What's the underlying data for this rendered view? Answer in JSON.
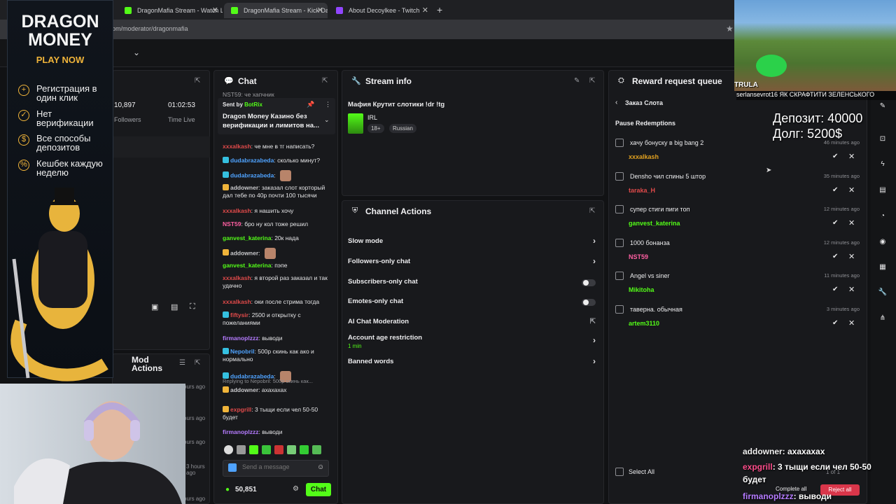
{
  "browser": {
    "tabs": [
      {
        "title": "DragonMafia Stream - Watch Li",
        "active": false
      },
      {
        "title": "DragonMafia Stream - Kick Da",
        "active": true
      },
      {
        "title": "About Decoylkee - Twitch",
        "active": false
      }
    ],
    "url": "om/moderator/dragonmafia"
  },
  "ad": {
    "title": "DRAGON MONEY",
    "cta": "PLAY NOW",
    "items": [
      "Регистрация в один клик",
      "Нет верификации",
      "Все способы депозитов",
      "Кешбек каждую неделю"
    ]
  },
  "stats": {
    "followers_value": "10,897",
    "followers_label": "Followers",
    "time_value": "01:02:53",
    "time_label": "Time Live"
  },
  "mod_actions": {
    "title": "Mod Actions",
    "times": [
      "ours ago",
      "ours ago",
      "ours ago",
      "ours ago",
      "3 hours ago",
      "ours ago"
    ]
  },
  "chat": {
    "title": "Chat",
    "top_cut": "NST59: че хапчник",
    "pinned": {
      "sent_by": "Sent by",
      "bot": "BotRix",
      "text": "Dragon Money Казино без верификации и лимитов на..."
    },
    "messages": [
      {
        "user": "xxxalkash",
        "color": "u-red",
        "badge": "",
        "text": "че мне в тг написать?"
      },
      {
        "user": "dudabrazabeda",
        "color": "u-blue",
        "badge": "k",
        "text": "сколько минут?"
      },
      {
        "user": "dudabrazabeda",
        "color": "u-blue",
        "badge": "k",
        "text": ""
      },
      {
        "user": "addowner",
        "color": "u-lt",
        "badge": "g",
        "text": "заказал слот корторый дал тебе по 40р почти 100 тысячи"
      },
      {
        "user": "xxxalkash",
        "color": "u-red",
        "badge": "",
        "text": "я нашить хочу"
      },
      {
        "user": "NST59",
        "color": "u-pink",
        "badge": "",
        "text": "бро ну кол тоже решил"
      },
      {
        "user": "ganvest_katerina",
        "color": "u-green",
        "badge": "",
        "text": "20к нада"
      },
      {
        "user": "addowner",
        "color": "u-lt",
        "badge": "g",
        "text": ""
      },
      {
        "user": "ganvest_katerina",
        "color": "u-green",
        "badge": "",
        "text": "пэпе"
      },
      {
        "user": "xxxalkash",
        "color": "u-red",
        "badge": "",
        "text": "я второй раз заказал и так удачно"
      },
      {
        "user": "xxxalkash",
        "color": "u-red",
        "badge": "",
        "text": "оки после стрима тогда"
      },
      {
        "user": "fiftysir",
        "color": "u-red",
        "badge": "k",
        "text": "2500 и открытку с пожеланиями"
      },
      {
        "user": "firmanoplzzz",
        "color": "u-purple",
        "badge": "",
        "text": "выводи"
      },
      {
        "user": "Nepobril",
        "color": "u-blue",
        "badge": "k",
        "text": "500р скинь как ако и нормально"
      },
      {
        "user": "dudabrazabeda",
        "color": "u-blue",
        "badge": "k",
        "text": ""
      },
      {
        "user": "addowner",
        "color": "u-lt",
        "badge": "g",
        "text": "ахахахах",
        "reply": "Replying to Nepobril: 500р скинь как..."
      },
      {
        "user": "expgrill",
        "color": "u-red",
        "badge": "g",
        "text": "3 тыщи если чел 50-50 будет"
      },
      {
        "user": "firmanoplzzz",
        "color": "u-purple",
        "badge": "",
        "text": "выводи"
      }
    ],
    "placeholder": "Send a message",
    "points": "50,851",
    "send_label": "Chat"
  },
  "stream_info": {
    "title": "Stream info",
    "stream_title": "Мафия Крутит слотики !dr !tg",
    "category": "IRL",
    "tags": [
      "18+",
      "Russian"
    ]
  },
  "channel_actions": {
    "title": "Channel Actions",
    "rows": [
      {
        "label": "Slow mode",
        "control": "chevron"
      },
      {
        "label": "Followers-only chat",
        "control": "chevron"
      },
      {
        "label": "Subscribers-only chat",
        "control": "toggle"
      },
      {
        "label": "Emotes-only chat",
        "control": "toggle"
      },
      {
        "label": "AI Chat Moderation",
        "control": "external"
      },
      {
        "label": "Account age restriction",
        "sub": "1 min",
        "control": "chevron"
      },
      {
        "label": "Banned words",
        "control": "chevron"
      }
    ]
  },
  "reward_queue": {
    "title": "Reward request queue",
    "back_label": "Заказ Слота",
    "pause_label": "Pause Redemptions",
    "select_all": "Select All",
    "page": "1 of 1",
    "complete_all": "Complete all",
    "reject_all": "Reject all",
    "items": [
      {
        "title": "хачу бонуску в big bang 2",
        "user": "xxxalkash",
        "color": "#e0a020",
        "time": "46 minutes ago"
      },
      {
        "title": "Densho чил спины 5 штор",
        "user": "taraka_H",
        "color": "#e04a4a",
        "time": "35 minutes ago"
      },
      {
        "title": "супер стиги пиги топ",
        "user": "ganvest_katerina",
        "color": "#53fc18",
        "time": "12 minutes ago"
      },
      {
        "title": "1000 бонанза",
        "user": "NST59",
        "color": "#ff5fa2",
        "time": "12 minutes ago"
      },
      {
        "title": "Angel vs siner",
        "user": "Mikitoha",
        "color": "#53fc18",
        "time": "11 minutes ago"
      },
      {
        "title": "таверна. обычная",
        "user": "artem3110",
        "color": "#53fc18",
        "time": "3 minutes ago"
      }
    ]
  },
  "overlay": {
    "game_name": "TRULA",
    "game_chat": "serlansevrot16 ЯК СКРАФТИТИ ЗЕЛЕНСЬКОГО",
    "deposit": "Депозит: 40000",
    "debt": "Долг: 5200$",
    "chat": [
      {
        "user": "addowner",
        "text": ": ахахахах",
        "color": "#f0f0f0"
      },
      {
        "user": "expgrill",
        "text": ": 3 тыщи если чел 50-50 будет",
        "color": "#ff4d8b"
      },
      {
        "user": "firmanoplzzz",
        "text": ": выводи",
        "color": "#b57bff"
      }
    ]
  }
}
